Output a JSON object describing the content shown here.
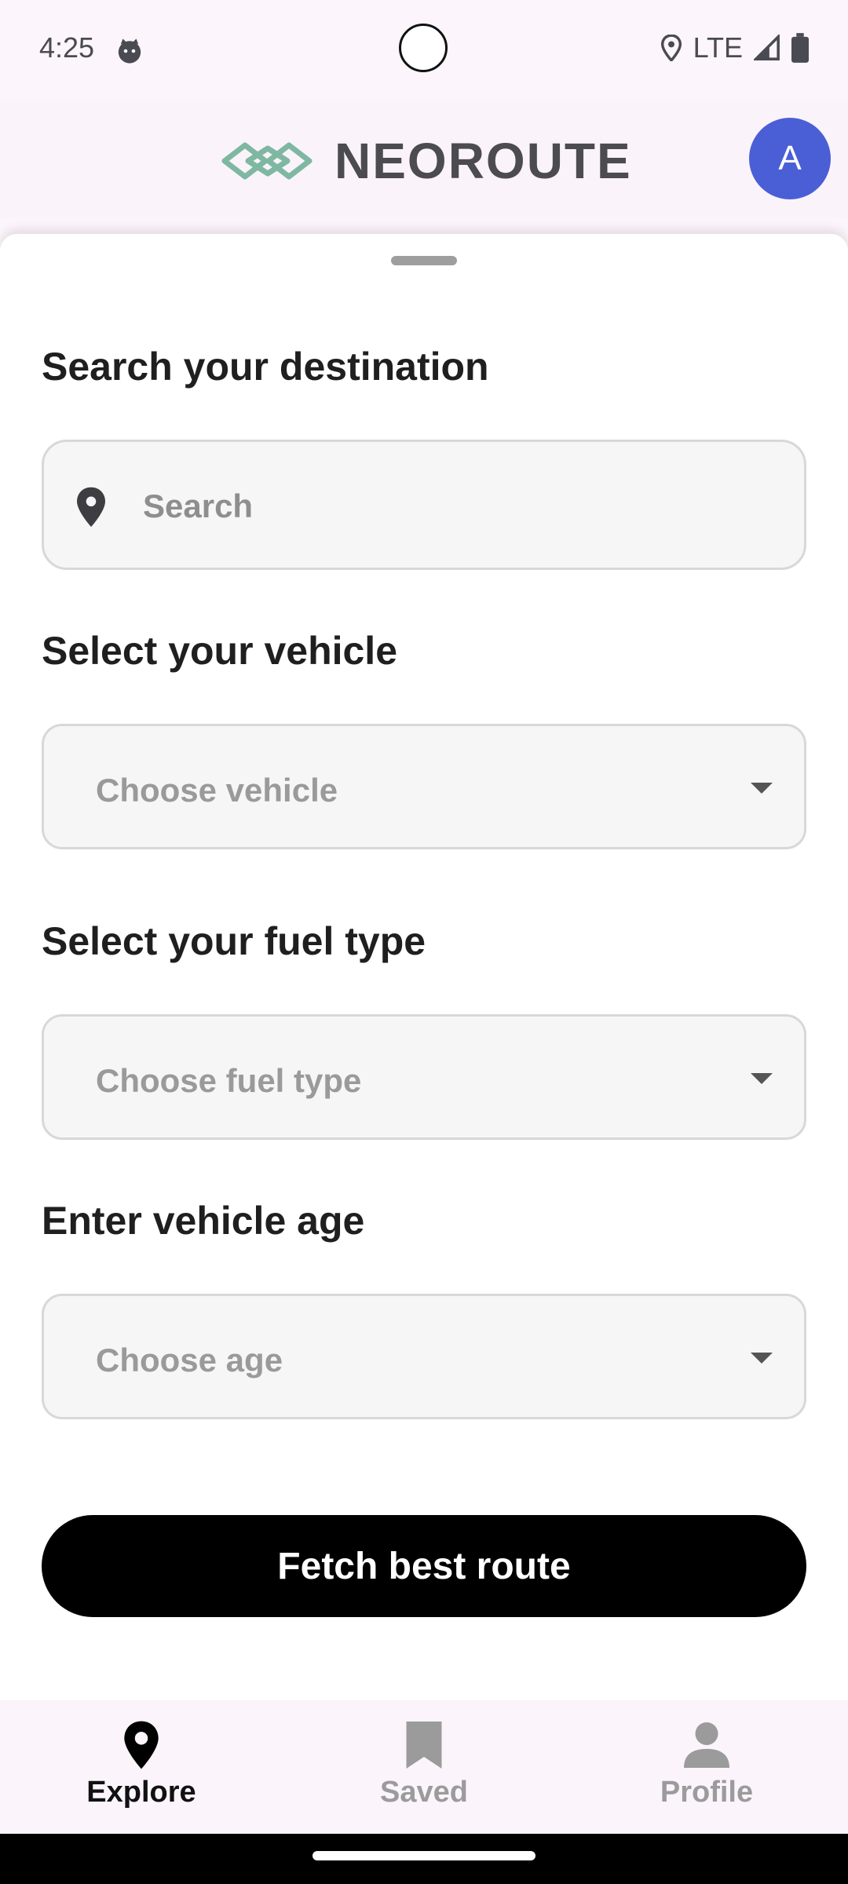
{
  "status_bar": {
    "time": "4:25",
    "network": "LTE"
  },
  "app_bar": {
    "brand": "NEOROUTE",
    "avatar_letter": "A",
    "logo_color": "#7fb8a2"
  },
  "form": {
    "destination_label": "Search your destination",
    "search_placeholder": "Search",
    "vehicle_label": "Select your vehicle",
    "vehicle_placeholder": "Choose vehicle",
    "fuel_label": "Select your fuel type",
    "fuel_placeholder": "Choose fuel type",
    "age_label": "Enter vehicle age",
    "age_placeholder": "Choose age",
    "submit_label": "Fetch best route"
  },
  "bottom_nav": {
    "items": [
      {
        "label": "Explore",
        "icon": "pin-icon",
        "active": true
      },
      {
        "label": "Saved",
        "icon": "bookmark-icon",
        "active": false
      },
      {
        "label": "Profile",
        "icon": "person-icon",
        "active": false
      }
    ]
  },
  "colors": {
    "accent": "#4a5fd6",
    "primary_button": "#000000",
    "inactive_nav": "#9b9b9b"
  }
}
